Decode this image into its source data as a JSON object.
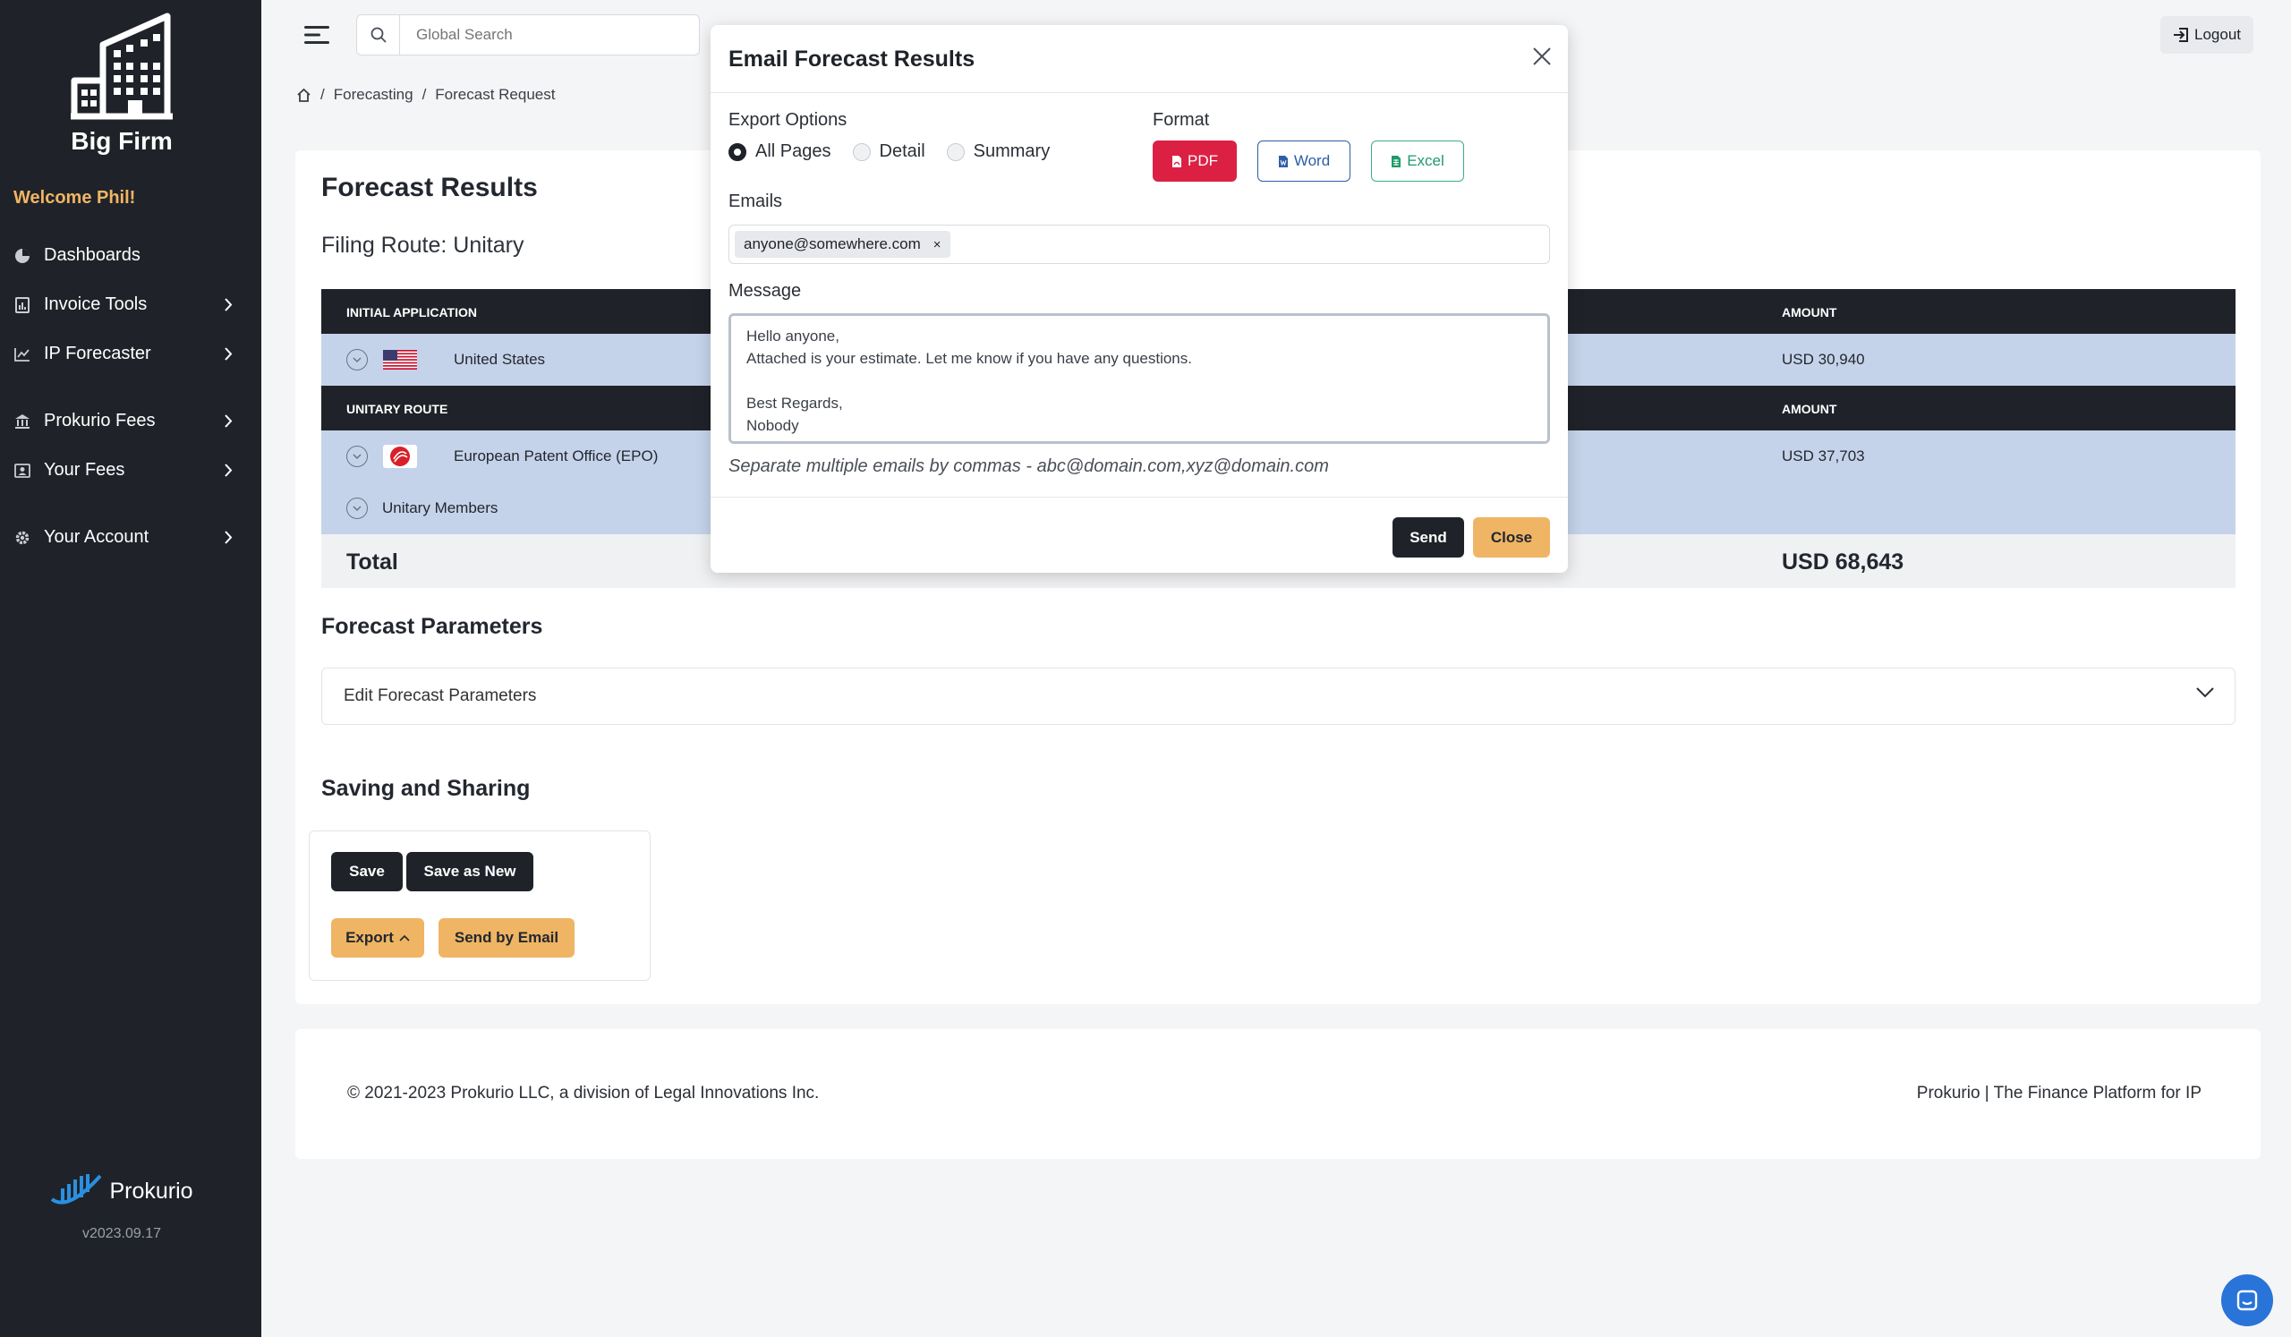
{
  "sidebar": {
    "brand_name": "Big Firm",
    "welcome": "Welcome Phil!",
    "items": [
      {
        "label": "Dashboards",
        "icon": "dashboard-icon"
      },
      {
        "label": "Invoice Tools",
        "icon": "invoice-icon"
      },
      {
        "label": "IP Forecaster",
        "icon": "chart-line-icon"
      },
      {
        "label": "Prokurio Fees",
        "icon": "bank-icon"
      },
      {
        "label": "Your Fees",
        "icon": "user-card-icon"
      },
      {
        "label": "Your Account",
        "icon": "gear-icon"
      }
    ],
    "product_name": "Prokurio",
    "version": "v2023.09.17"
  },
  "topbar": {
    "search_placeholder": "Global Search",
    "logout_label": "Logout"
  },
  "breadcrumb": {
    "items": [
      "Forecasting",
      "Forecast Request"
    ]
  },
  "main": {
    "title": "Forecast Results",
    "subtitle": "Filing Route: Unitary",
    "table": {
      "initial_header": "INITIAL APPLICATION",
      "amount_header": "AMOUNT",
      "initial_rows": [
        {
          "label": "United States",
          "amount": "USD 30,940"
        }
      ],
      "route_header": "UNITARY ROUTE",
      "route_rows": [
        {
          "label": "European Patent Office (EPO)",
          "amount": "USD 37,703"
        },
        {
          "label": "Unitary Members",
          "amount": ""
        }
      ],
      "total_label": "Total",
      "total_value": "USD 68,643"
    },
    "forecast_params_heading": "Forecast Parameters",
    "edit_params_label": "Edit Forecast Parameters",
    "saving_heading": "Saving and Sharing",
    "buttons": {
      "save": "Save",
      "save_as_new": "Save as New",
      "export": "Export",
      "send_by_email": "Send by Email"
    }
  },
  "footer": {
    "copyright": "© 2021-2023 Prokurio LLC, a division of Legal Innovations Inc.",
    "tagline": "Prokurio | The Finance Platform for IP"
  },
  "modal": {
    "title": "Email Forecast Results",
    "export_options_label": "Export Options",
    "export_options": [
      "All Pages",
      "Detail",
      "Summary"
    ],
    "export_selected": "All Pages",
    "format_label": "Format",
    "formats": {
      "pdf": "PDF",
      "word": "Word",
      "excel": "Excel"
    },
    "emails_label": "Emails",
    "emails": [
      "anyone@somewhere.com"
    ],
    "message_label": "Message",
    "message": "Hello anyone,\nAttached is your estimate. Let me know if you have any questions.\n\nBest Regards,\nNobody",
    "hint": "Separate multiple emails by commas - abc@domain.com,xyz@domain.com",
    "send_label": "Send",
    "close_label": "Close"
  },
  "colors": {
    "sidebar_bg": "#1f2329",
    "accent_amber": "#efb564",
    "row_blue": "#c5d3ea",
    "pdf_red": "#dc2044",
    "word_blue": "#2c5ea8",
    "excel_green": "#1f9a6a"
  }
}
